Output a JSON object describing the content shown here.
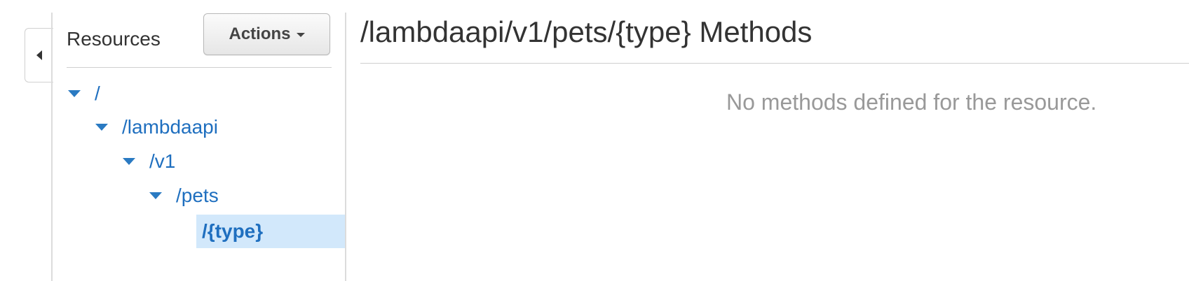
{
  "sidebar": {
    "collapse_icon": "caret-left-icon",
    "title": "Resources",
    "actions_label": "Actions",
    "actions_icon": "chevron-down-icon",
    "tree": [
      {
        "label": "/",
        "expanded": true,
        "depth": 0
      },
      {
        "label": "/lambdaapi",
        "expanded": true,
        "depth": 1
      },
      {
        "label": "/v1",
        "expanded": true,
        "depth": 2
      },
      {
        "label": "/pets",
        "expanded": true,
        "depth": 3
      },
      {
        "label": "/{type}",
        "selected": true,
        "depth": 4
      }
    ]
  },
  "main": {
    "title": "/lambdaapi/v1/pets/{type} Methods",
    "empty_message": "No methods defined for the resource."
  },
  "colors": {
    "link": "#1f6fbf",
    "selected_bg": "#d2e8fb",
    "muted_text": "#999999"
  }
}
